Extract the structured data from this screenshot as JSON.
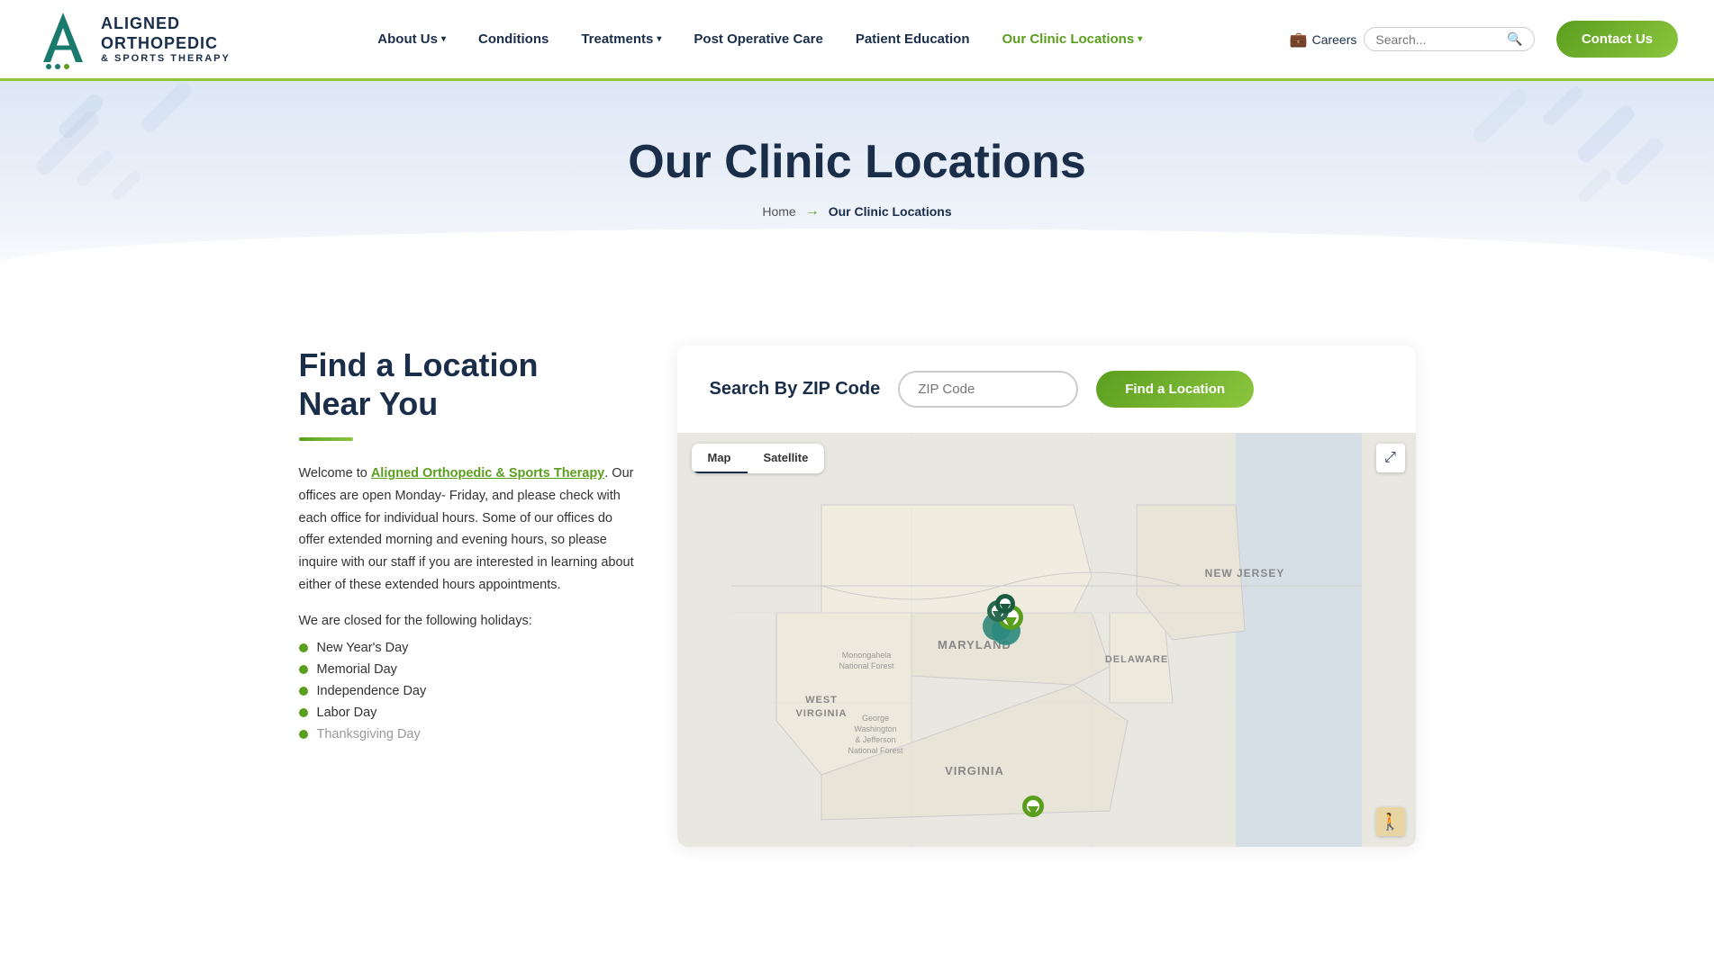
{
  "header": {
    "logo": {
      "brand_name": "ALIGNED\nORTHOPEDIC",
      "brand_line1": "ALIGNED",
      "brand_line2": "ORTHOPEDIC",
      "brand_line3": "& SPORTS THERAPY"
    },
    "careers_label": "Careers",
    "search_placeholder": "Search...",
    "nav_items": [
      {
        "id": "about-us",
        "label": "About Us",
        "has_dropdown": true
      },
      {
        "id": "conditions",
        "label": "Conditions",
        "has_dropdown": false
      },
      {
        "id": "treatments",
        "label": "Treatments",
        "has_dropdown": true
      },
      {
        "id": "post-op",
        "label": "Post Operative Care",
        "has_dropdown": false
      },
      {
        "id": "patient-edu",
        "label": "Patient Education",
        "has_dropdown": false
      },
      {
        "id": "clinic-locations",
        "label": "Our Clinic Locations",
        "has_dropdown": true,
        "is_green": true
      }
    ],
    "contact_us_label": "Contact Us"
  },
  "hero": {
    "title": "Our Clinic Locations",
    "breadcrumb_home": "Home",
    "breadcrumb_current": "Our Clinic Locations"
  },
  "main": {
    "left": {
      "section_title_line1": "Find a Location",
      "section_title_line2": "Near You",
      "description_part1": "Welcome to ",
      "description_link": "Aligned Orthopedic & Sports Therapy",
      "description_part2": ". Our offices are open Monday- Friday, and please check with each office for individual hours. Some of our offices do offer extended morning and evening hours, so please inquire with our staff if you are interested in learning about either of these extended hours appointments.",
      "holidays_intro": "We are closed for the following holidays:",
      "holidays": [
        "New Year's Day",
        "Memorial Day",
        "Independence Day",
        "Labor Day",
        "Thanksgiving Day"
      ]
    },
    "right": {
      "search_label": "Search By ZIP Code",
      "zip_placeholder": "ZIP Code",
      "find_button": "Find a Location",
      "map_tab_map": "Map",
      "map_tab_satellite": "Satellite",
      "fullscreen_icon": "⤢",
      "pegman_icon": "🚶",
      "map_labels": [
        {
          "id": "maryland",
          "text": "MARYLAND"
        },
        {
          "id": "new-jersey",
          "text": "NEW JERSEY"
        },
        {
          "id": "delaware",
          "text": "DELAWARE"
        },
        {
          "id": "west-virginia",
          "text": "WEST\nVIRGINIA"
        },
        {
          "id": "virginia",
          "text": "VIRGINIA"
        },
        {
          "id": "monongahela",
          "text": "Monongahela\nNational Forest"
        },
        {
          "id": "gwj-forest",
          "text": "George\nWashington\n& Jefferson\nNational Forest"
        }
      ]
    }
  }
}
